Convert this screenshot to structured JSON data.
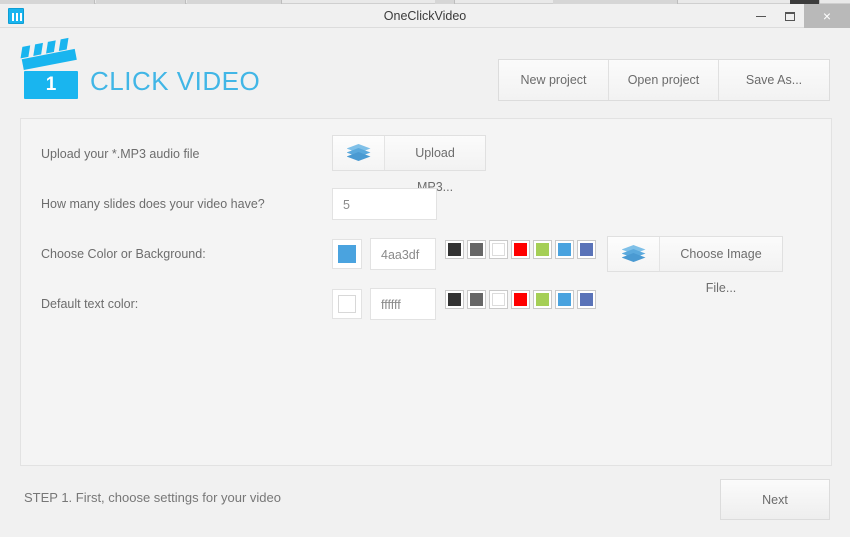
{
  "window": {
    "title": "OneClickVideo",
    "app_icon": "app-icon",
    "controls": {
      "minimize": "minimize-icon",
      "maximize": "maximize-icon",
      "close": "×"
    }
  },
  "header": {
    "logo": {
      "badge_number": "1",
      "wordmark": "CLICK VIDEO",
      "icon": "clapperboard-icon",
      "color": "#41b6e6"
    },
    "project_buttons": [
      {
        "label": "New project",
        "name": "new-project-button"
      },
      {
        "label": "Open project",
        "name": "open-project-button"
      },
      {
        "label": "Save As...",
        "name": "save-as-button"
      }
    ]
  },
  "form": {
    "rows": [
      {
        "label": "Upload your *.MP3 audio file",
        "control": "file-picker",
        "button_label": "Upload MP3...",
        "icon": "stack-icon"
      },
      {
        "label": "How many slides does your video have?",
        "control": "number-input",
        "value": "5",
        "placeholder": "5"
      },
      {
        "label": "Choose Color or Background:",
        "control": "color-picker",
        "value": "4aa3df",
        "swatch_color": "#4aa3df",
        "placeholder": "4aa3df",
        "image_button_label": "Choose Image File...",
        "image_button_icon": "stack-icon"
      },
      {
        "label": "Default text color:",
        "control": "color-picker",
        "value": "ffffff",
        "swatch_color": "#ffffff",
        "placeholder": "ffffff"
      }
    ],
    "palette": [
      {
        "name": "swatch-dark-gray",
        "color": "#333333"
      },
      {
        "name": "swatch-gray",
        "color": "#666666"
      },
      {
        "name": "swatch-white",
        "color": "#ffffff"
      },
      {
        "name": "swatch-red",
        "color": "#ff0000"
      },
      {
        "name": "swatch-green",
        "color": "#a5cf56"
      },
      {
        "name": "swatch-blue",
        "color": "#4aa3df"
      },
      {
        "name": "swatch-slate-blue",
        "color": "#5a73b8"
      }
    ]
  },
  "footer": {
    "step_text": "STEP 1. First, choose settings for your video",
    "next_label": "Next"
  }
}
